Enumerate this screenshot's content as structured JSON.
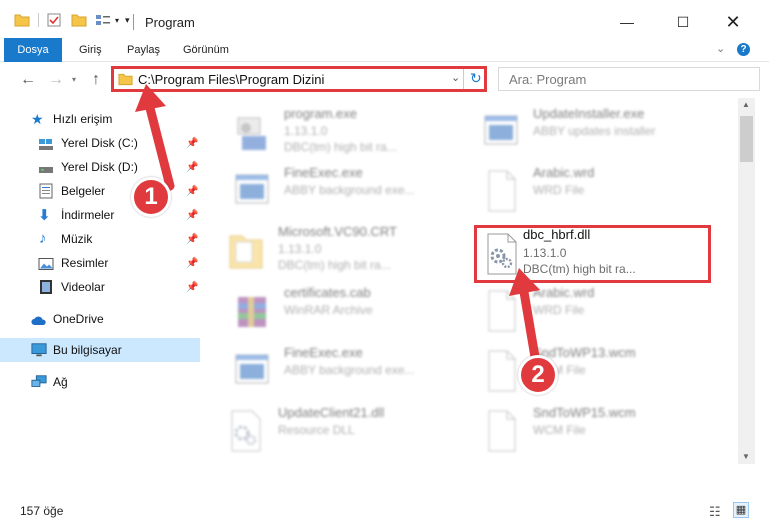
{
  "window": {
    "title": "Program"
  },
  "ribbon": {
    "tabs": [
      "Dosya",
      "Giriş",
      "Paylaş",
      "Görünüm"
    ]
  },
  "address": {
    "path": "C:\\Program Files\\Program Dizini"
  },
  "search": {
    "placeholder": "Ara: Program"
  },
  "sidebar": {
    "items": [
      {
        "label": "Hızlı erişim",
        "icon": "star-icon"
      },
      {
        "label": "Yerel Disk (C:)",
        "icon": "drive-icon",
        "pinned": true
      },
      {
        "label": "Yerel Disk (D:)",
        "icon": "drive-icon",
        "pinned": true
      },
      {
        "label": "Belgeler",
        "icon": "document-icon",
        "pinned": true
      },
      {
        "label": "İndirmeler",
        "icon": "download-icon",
        "pinned": true
      },
      {
        "label": "Müzik",
        "icon": "music-icon",
        "pinned": true
      },
      {
        "label": "Resimler",
        "icon": "pictures-icon",
        "pinned": true
      },
      {
        "label": "Videolar",
        "icon": "video-icon",
        "pinned": true
      },
      {
        "label": "OneDrive",
        "icon": "cloud-icon"
      },
      {
        "label": "Bu bilgisayar",
        "icon": "computer-icon",
        "selected": true
      },
      {
        "label": "Ağ",
        "icon": "network-icon"
      }
    ]
  },
  "files": [
    {
      "name": "program.exe",
      "l2": "1.13.1.0",
      "l3": "DBC(tm) high bit ra..."
    },
    {
      "name": "UpdateInstaller.exe",
      "l2": "ABBY updates installer",
      "l3": ""
    },
    {
      "name": "FineExec.exe",
      "l2": "ABBY background exe...",
      "l3": ""
    },
    {
      "name": "Arabic.wrd",
      "l2": "WRD File",
      "l3": ""
    },
    {
      "name": "Microsoft.VC90.CRT",
      "l2": "1.13.1.0",
      "l3": "DBC(tm) high bit ra..."
    },
    {
      "name": "dbc_hbrf.dll",
      "l2": "1.13.1.0",
      "l3": "DBC(tm) high bit ra..."
    },
    {
      "name": "certificates.cab",
      "l2": "WinRAR Archive",
      "l3": ""
    },
    {
      "name": "Arabic.wrd",
      "l2": "WRD File",
      "l3": ""
    },
    {
      "name": "FineExec.exe",
      "l2": "ABBY background exe...",
      "l3": ""
    },
    {
      "name": "SndToWP13.wcm",
      "l2": "WCM File",
      "l3": ""
    },
    {
      "name": "UpdateClient21.dll",
      "l2": "Resource DLL",
      "l3": ""
    },
    {
      "name": "SndToWP15.wcm",
      "l2": "WCM File",
      "l3": ""
    }
  ],
  "status": {
    "count": "157 öğe"
  },
  "callouts": [
    "1",
    "2"
  ],
  "colors": {
    "accent": "#1979ca",
    "highlight": "#e03a3e",
    "selected": "#cce8ff"
  }
}
